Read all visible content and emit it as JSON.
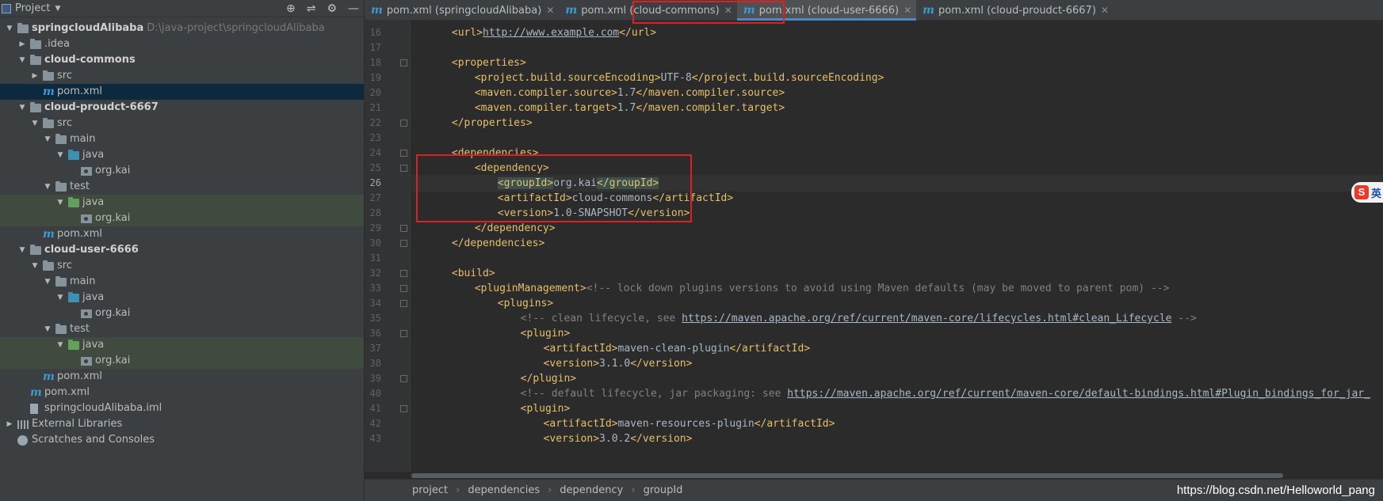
{
  "project_panel": {
    "title": "Project",
    "tools": [
      "locate-icon",
      "collapse-icon",
      "gear-icon",
      "hide-icon"
    ],
    "tree": [
      {
        "label": "springcloudAlibaba",
        "path": "D:\\java-project\\springcloudAlibaba",
        "depth": 0,
        "expanded": true,
        "icon": "module-folder",
        "bold": true
      },
      {
        "label": ".idea",
        "depth": 1,
        "expanded": false,
        "icon": "folder"
      },
      {
        "label": "cloud-commons",
        "depth": 1,
        "expanded": true,
        "icon": "module-folder",
        "bold": true
      },
      {
        "label": "src",
        "depth": 2,
        "expanded": false,
        "icon": "folder"
      },
      {
        "label": "pom.xml",
        "depth": 2,
        "icon": "maven-file",
        "selected": true
      },
      {
        "label": "cloud-proudct-6667",
        "depth": 1,
        "expanded": true,
        "icon": "module-folder",
        "bold": true
      },
      {
        "label": "src",
        "depth": 2,
        "expanded": true,
        "icon": "folder"
      },
      {
        "label": "main",
        "depth": 3,
        "expanded": true,
        "icon": "folder"
      },
      {
        "label": "java",
        "depth": 4,
        "expanded": true,
        "icon": "source-folder"
      },
      {
        "label": "org.kai",
        "depth": 5,
        "icon": "package"
      },
      {
        "label": "test",
        "depth": 3,
        "expanded": true,
        "icon": "folder"
      },
      {
        "label": "java",
        "depth": 4,
        "expanded": true,
        "icon": "test-folder",
        "highlight": true
      },
      {
        "label": "org.kai",
        "depth": 5,
        "icon": "package",
        "highlight": true
      },
      {
        "label": "pom.xml",
        "depth": 2,
        "icon": "maven-file"
      },
      {
        "label": "cloud-user-6666",
        "depth": 1,
        "expanded": true,
        "icon": "module-folder",
        "bold": true
      },
      {
        "label": "src",
        "depth": 2,
        "expanded": true,
        "icon": "folder"
      },
      {
        "label": "main",
        "depth": 3,
        "expanded": true,
        "icon": "folder"
      },
      {
        "label": "java",
        "depth": 4,
        "expanded": true,
        "icon": "source-folder"
      },
      {
        "label": "org.kai",
        "depth": 5,
        "icon": "package"
      },
      {
        "label": "test",
        "depth": 3,
        "expanded": true,
        "icon": "folder"
      },
      {
        "label": "java",
        "depth": 4,
        "expanded": true,
        "icon": "test-folder",
        "highlight": true
      },
      {
        "label": "org.kai",
        "depth": 5,
        "icon": "package",
        "highlight": true
      },
      {
        "label": "pom.xml",
        "depth": 2,
        "icon": "maven-file"
      },
      {
        "label": "pom.xml",
        "depth": 1,
        "icon": "maven-file"
      },
      {
        "label": "springcloudAlibaba.iml",
        "depth": 1,
        "icon": "iml-file"
      },
      {
        "label": "External Libraries",
        "depth": 0,
        "expanded": false,
        "icon": "library"
      },
      {
        "label": "Scratches and Consoles",
        "depth": 0,
        "icon": "scratch"
      }
    ]
  },
  "tabs": [
    {
      "label": "pom.xml (springcloudAlibaba)",
      "active": false
    },
    {
      "label": "pom.xml (cloud-commons)",
      "active": false
    },
    {
      "label": "pom.xml (cloud-user-6666)",
      "active": true
    },
    {
      "label": "pom.xml (cloud-proudct-6667)",
      "active": false
    }
  ],
  "editor": {
    "current_line": 26,
    "lines": [
      {
        "n": 16,
        "indent": 4,
        "parts": [
          [
            "tag",
            "<url>"
          ],
          [
            "url",
            "http://www.example.com"
          ],
          [
            "tag",
            "</url>"
          ]
        ]
      },
      {
        "n": 17,
        "indent": 0,
        "parts": []
      },
      {
        "n": 18,
        "indent": 4,
        "fold": true,
        "parts": [
          [
            "tag",
            "<properties>"
          ]
        ]
      },
      {
        "n": 19,
        "indent": 8,
        "parts": [
          [
            "tag",
            "<project.build.sourceEncoding>"
          ],
          [
            "txt",
            "UTF-8"
          ],
          [
            "tag",
            "</project.build.sourceEncoding>"
          ]
        ]
      },
      {
        "n": 20,
        "indent": 8,
        "parts": [
          [
            "tag",
            "<maven.compiler.source>"
          ],
          [
            "txt",
            "1.7"
          ],
          [
            "tag",
            "</maven.compiler.source>"
          ]
        ]
      },
      {
        "n": 21,
        "indent": 8,
        "parts": [
          [
            "tag",
            "<maven.compiler.target>"
          ],
          [
            "txt",
            "1.7"
          ],
          [
            "tag",
            "</maven.compiler.target>"
          ]
        ]
      },
      {
        "n": 22,
        "indent": 4,
        "fold": true,
        "parts": [
          [
            "tag",
            "</properties>"
          ]
        ]
      },
      {
        "n": 23,
        "indent": 0,
        "parts": []
      },
      {
        "n": 24,
        "indent": 4,
        "fold": true,
        "parts": [
          [
            "tag",
            "<dependencies>"
          ]
        ]
      },
      {
        "n": 25,
        "indent": 8,
        "fold": true,
        "parts": [
          [
            "tag",
            "<dependency>"
          ]
        ]
      },
      {
        "n": 26,
        "indent": 12,
        "parts": [
          [
            "hltag",
            "<groupId>"
          ],
          [
            "txt",
            "org.kai"
          ],
          [
            "hltag",
            "</groupId>"
          ]
        ]
      },
      {
        "n": 27,
        "indent": 12,
        "parts": [
          [
            "tag",
            "<artifactId>"
          ],
          [
            "txt",
            "cloud-commons"
          ],
          [
            "tag",
            "</artifactId>"
          ]
        ]
      },
      {
        "n": 28,
        "indent": 12,
        "parts": [
          [
            "tag",
            "<version>"
          ],
          [
            "txt",
            "1.0-SNAPSHOT"
          ],
          [
            "tag",
            "</version>"
          ]
        ]
      },
      {
        "n": 29,
        "indent": 8,
        "fold": true,
        "parts": [
          [
            "tag",
            "</dependency>"
          ]
        ]
      },
      {
        "n": 30,
        "indent": 4,
        "fold": true,
        "parts": [
          [
            "tag",
            "</dependencies>"
          ]
        ]
      },
      {
        "n": 31,
        "indent": 0,
        "parts": []
      },
      {
        "n": 32,
        "indent": 4,
        "fold": true,
        "parts": [
          [
            "tag",
            "<build>"
          ]
        ]
      },
      {
        "n": 33,
        "indent": 8,
        "fold": true,
        "parts": [
          [
            "tag",
            "<pluginManagement>"
          ],
          [
            "cm",
            "<!-- lock down plugins versions to avoid using Maven defaults (may be moved to parent pom) -->"
          ]
        ]
      },
      {
        "n": 34,
        "indent": 12,
        "fold": true,
        "parts": [
          [
            "tag",
            "<plugins>"
          ]
        ]
      },
      {
        "n": 35,
        "indent": 16,
        "parts": [
          [
            "cm",
            "<!-- clean lifecycle, see "
          ],
          [
            "cmurl",
            "https://maven.apache.org/ref/current/maven-core/lifecycles.html#clean_Lifecycle"
          ],
          [
            "cm",
            " -->"
          ]
        ]
      },
      {
        "n": 36,
        "indent": 16,
        "fold": true,
        "parts": [
          [
            "tag",
            "<plugin>"
          ]
        ]
      },
      {
        "n": 37,
        "indent": 20,
        "parts": [
          [
            "tag",
            "<artifactId>"
          ],
          [
            "txt",
            "maven-clean-plugin"
          ],
          [
            "tag",
            "</artifactId>"
          ]
        ]
      },
      {
        "n": 38,
        "indent": 20,
        "parts": [
          [
            "tag",
            "<version>"
          ],
          [
            "txt",
            "3.1.0"
          ],
          [
            "tag",
            "</version>"
          ]
        ]
      },
      {
        "n": 39,
        "indent": 16,
        "fold": true,
        "parts": [
          [
            "tag",
            "</plugin>"
          ]
        ]
      },
      {
        "n": 40,
        "indent": 16,
        "parts": [
          [
            "cm",
            "<!-- default lifecycle, jar packaging: see "
          ],
          [
            "cmurl",
            "https://maven.apache.org/ref/current/maven-core/default-bindings.html#Plugin_bindings_for_jar_"
          ]
        ]
      },
      {
        "n": 41,
        "indent": 16,
        "fold": true,
        "parts": [
          [
            "tag",
            "<plugin>"
          ]
        ]
      },
      {
        "n": 42,
        "indent": 20,
        "parts": [
          [
            "tag",
            "<artifactId>"
          ],
          [
            "txt",
            "maven-resources-plugin"
          ],
          [
            "tag",
            "</artifactId>"
          ]
        ]
      },
      {
        "n": 43,
        "indent": 20,
        "parts": [
          [
            "tag",
            "<version>"
          ],
          [
            "txt",
            "3.0.2"
          ],
          [
            "tag",
            "</version>"
          ]
        ]
      }
    ]
  },
  "breadcrumb": [
    "project",
    "dependencies",
    "dependency",
    "groupId"
  ],
  "watermark": "https://blog.csdn.net/Helloworld_pang",
  "ime": {
    "logo": "S",
    "mode": "英"
  },
  "colors": {
    "accent": "#4a88c7",
    "annotation_box": "#e02020",
    "tag": "#e8bf6a",
    "comment": "#808080"
  }
}
